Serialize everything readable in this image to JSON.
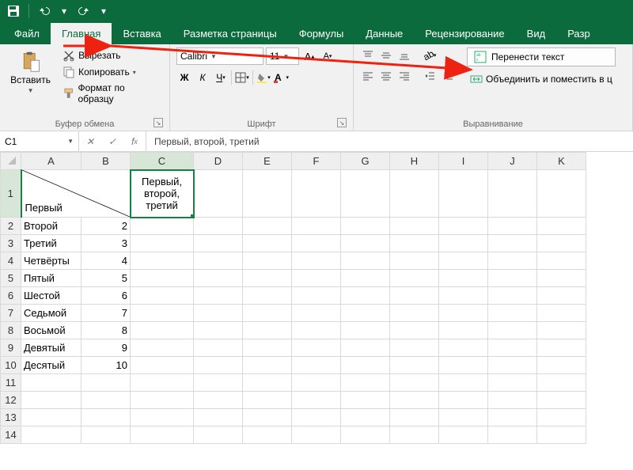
{
  "qat": {
    "save_tip": "Сохранить",
    "undo_tip": "Отменить",
    "redo_tip": "Повторить"
  },
  "tabs": {
    "file": "Файл",
    "home": "Главная",
    "insert": "Вставка",
    "layout": "Разметка страницы",
    "formulas": "Формулы",
    "data": "Данные",
    "review": "Рецензирование",
    "view": "Вид",
    "dev": "Разр"
  },
  "ribbon": {
    "clipboard": {
      "paste": "Вставить",
      "cut": "Вырезать",
      "copy": "Копировать",
      "format_painter": "Формат по образцу",
      "label": "Буфер обмена"
    },
    "font": {
      "name": "Calibri",
      "size": "11",
      "bold_glyph": "Ж",
      "italic_glyph": "К",
      "underline_glyph": "Ч",
      "label": "Шрифт"
    },
    "alignment": {
      "wrap_text": "Перенести текст",
      "merge": "Объединить и поместить в ц",
      "label": "Выравнивание"
    }
  },
  "namebox": "C1",
  "formula": "Первый, второй, третий",
  "columns": [
    "A",
    "B",
    "C",
    "D",
    "E",
    "F",
    "G",
    "H",
    "I",
    "J",
    "K"
  ],
  "selected_col": "C",
  "selected_row": 1,
  "chart_data": {
    "type": "table",
    "columns": [
      "A",
      "B",
      "C"
    ],
    "rows": [
      {
        "row": 1,
        "A": "Первый",
        "B": "",
        "C": "Первый, второй, третий"
      },
      {
        "row": 2,
        "A": "Второй",
        "B": 2,
        "C": ""
      },
      {
        "row": 3,
        "A": "Третий",
        "B": 3,
        "C": ""
      },
      {
        "row": 4,
        "A": "Четвёрты",
        "B": 4,
        "C": ""
      },
      {
        "row": 5,
        "A": "Пятый",
        "B": 5,
        "C": ""
      },
      {
        "row": 6,
        "A": "Шестой",
        "B": 6,
        "C": ""
      },
      {
        "row": 7,
        "A": "Седьмой",
        "B": 7,
        "C": ""
      },
      {
        "row": 8,
        "A": "Восьмой",
        "B": 8,
        "C": ""
      },
      {
        "row": 9,
        "A": "Девятый",
        "B": 9,
        "C": ""
      },
      {
        "row": 10,
        "A": "Десятый",
        "B": 10,
        "C": ""
      }
    ]
  },
  "cells": {
    "r1": {
      "A_label": "Первый",
      "C": "Первый, второй, третий"
    },
    "r2": {
      "A": "Второй",
      "B": "2"
    },
    "r3": {
      "A": "Третий",
      "B": "3"
    },
    "r4": {
      "A": "Четвёрты",
      "B": "4"
    },
    "r5": {
      "A": "Пятый",
      "B": "5"
    },
    "r6": {
      "A": "Шестой",
      "B": "6"
    },
    "r7": {
      "A": "Седьмой",
      "B": "7"
    },
    "r8": {
      "A": "Восьмой",
      "B": "8"
    },
    "r9": {
      "A": "Девятый",
      "B": "9"
    },
    "r10": {
      "A": "Десятый",
      "B": "10"
    }
  }
}
